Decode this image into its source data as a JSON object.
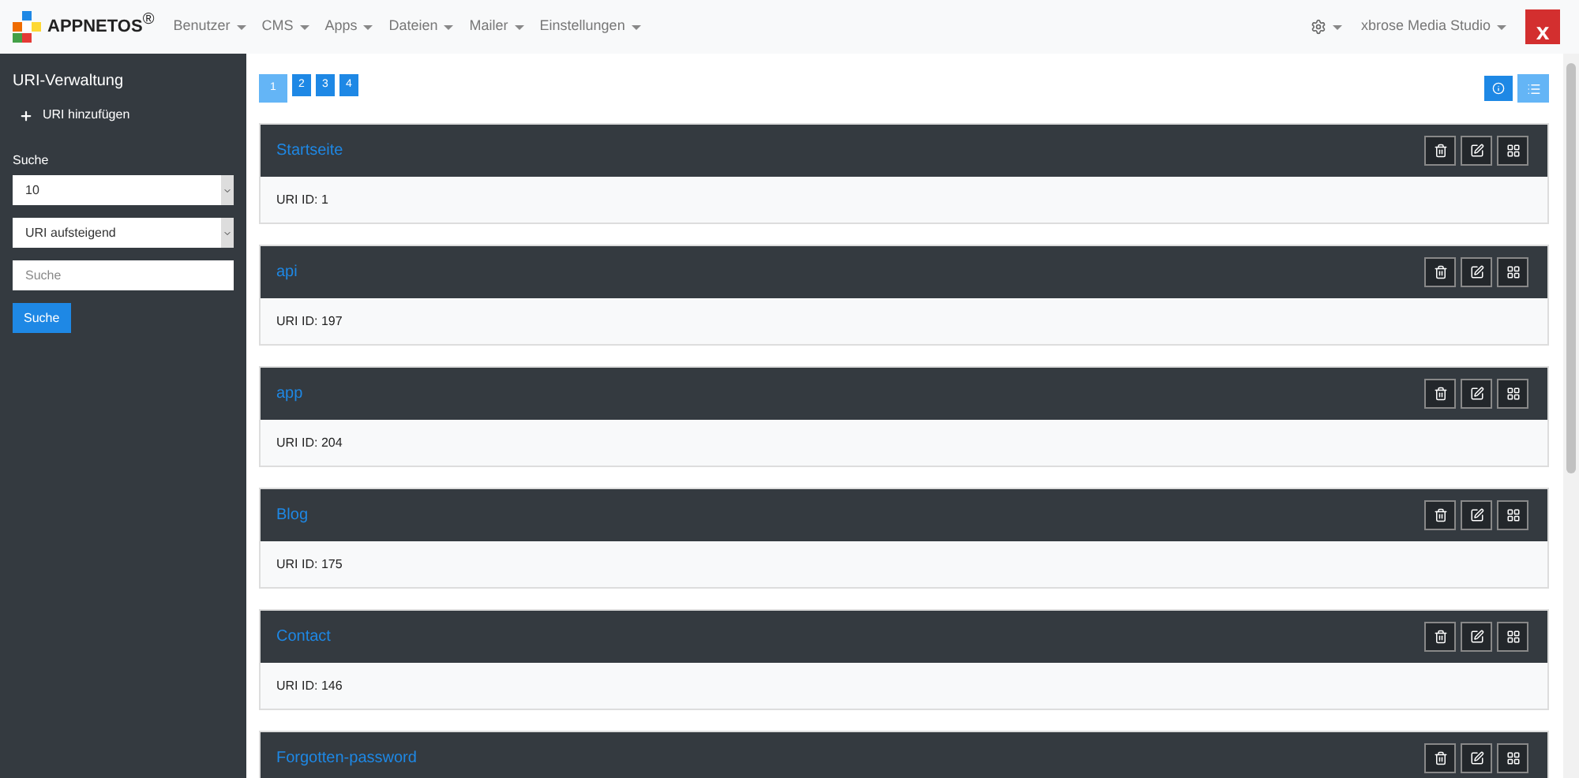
{
  "brand": {
    "name": "APPNETOS",
    "mark": "®"
  },
  "nav": [
    "Benutzer",
    "CMS",
    "Apps",
    "Dateien",
    "Mailer",
    "Einstellungen"
  ],
  "user_menu": {
    "label": "xbrose Media Studio",
    "logo": "x"
  },
  "sidebar": {
    "title": "URI-Verwaltung",
    "add_link": "URI hinzufügen",
    "search_label": "Suche",
    "per_page": "10",
    "sort": "URI aufsteigend",
    "search_placeholder": "Suche",
    "search_button": "Suche"
  },
  "pagination": [
    {
      "label": "1",
      "selected": true
    },
    {
      "label": "2",
      "selected": false
    },
    {
      "label": "3",
      "selected": false
    },
    {
      "label": "4",
      "selected": false
    }
  ],
  "view_toggle": [
    {
      "kind": "info",
      "selected": false
    },
    {
      "kind": "list",
      "selected": true
    }
  ],
  "uris": [
    {
      "title": "Startseite",
      "id_text": "URI ID: 1"
    },
    {
      "title": "api",
      "id_text": "URI ID: 197"
    },
    {
      "title": "app",
      "id_text": "URI ID: 204"
    },
    {
      "title": "Blog",
      "id_text": "URI ID: 175"
    },
    {
      "title": "Contact",
      "id_text": "URI ID: 146"
    },
    {
      "title": "Forgotten-password"
    }
  ]
}
